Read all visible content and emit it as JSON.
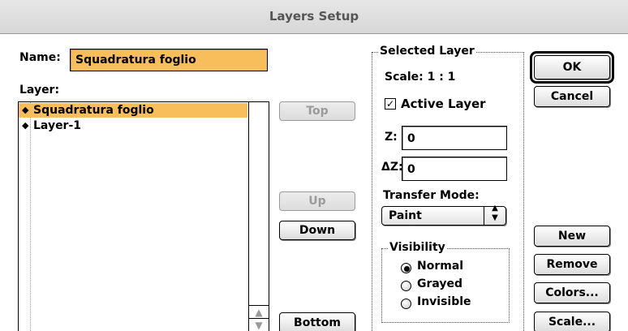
{
  "window": {
    "title": "Layers Setup"
  },
  "name_field": {
    "label": "Name:",
    "value": "Squadratura foglio"
  },
  "layer_list": {
    "label": "Layer:",
    "items": [
      {
        "marker": "◆",
        "label": "Squadratura foglio",
        "selected": true
      },
      {
        "marker": "◆",
        "label": "Layer-1",
        "selected": false
      }
    ],
    "scroll_up_glyph": "▲",
    "scroll_down_glyph": "▼"
  },
  "order_buttons": {
    "top": "Top",
    "up": "Up",
    "down": "Down",
    "bottom": "Bottom"
  },
  "selected_layer": {
    "legend": "Selected Layer",
    "scale": "Scale: 1 : 1",
    "active_checkbox": {
      "label": "Active Layer",
      "checked": true,
      "glyph": "☑"
    },
    "z_label": "Z:",
    "z_value": "0",
    "dz_label": "ΔZ:",
    "dz_value": "0",
    "transfer_mode_label": "Transfer Mode:",
    "transfer_mode_value": "Paint",
    "popup_arrows": "▲▼"
  },
  "visibility": {
    "legend": "Visibility",
    "options": [
      {
        "label": "Normal",
        "selected": true
      },
      {
        "label": "Grayed",
        "selected": false
      },
      {
        "label": "Invisible",
        "selected": false
      }
    ]
  },
  "dialog_buttons": {
    "ok": "OK",
    "cancel": "Cancel",
    "new": "New",
    "remove": "Remove",
    "colors": "Colors...",
    "scale": "Scale..."
  },
  "colors": {
    "selection_highlight": "#f7be5b",
    "disabled_text": "#9a9a9a"
  }
}
